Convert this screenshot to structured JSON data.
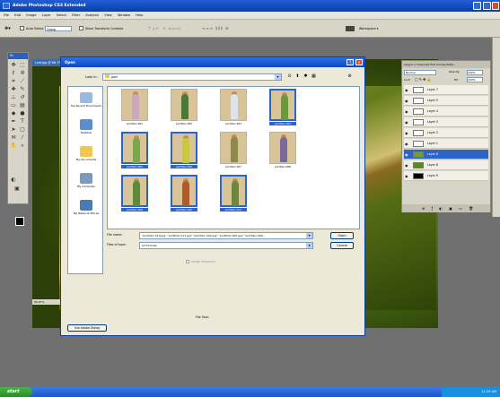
{
  "app": {
    "title": "Adobe Photoshop CS3 Extended",
    "accent": "#0a3ea8"
  },
  "menubar": [
    "File",
    "Edit",
    "Image",
    "Layer",
    "Select",
    "Filter",
    "Analysis",
    "View",
    "Window",
    "Help"
  ],
  "options_bar": {
    "auto_select_label": "Auto Select",
    "auto_select_value": "Group",
    "show_transform_label": "Show Transform Controls",
    "workspace_label": "Workspace ▾"
  },
  "toolbox": {
    "title": "Ps"
  },
  "document": {
    "title": "Leaf.jpg @ 66.7%",
    "zoom": "66.67%"
  },
  "layers_panel": {
    "tabs": "Layers × Channels  Hist Comps  Paths",
    "blend_mode": "Normal",
    "opacity_label": "Opacity:",
    "opacity_value": "100%",
    "lock_label": "Lock:",
    "fill_label": "Fill:",
    "fill_value": "100%",
    "layers": [
      {
        "name": "Layer 7",
        "selected": false,
        "thumb": "#ffffff"
      },
      {
        "name": "Layer 5",
        "selected": false,
        "thumb": "#ffffff"
      },
      {
        "name": "Layer 4",
        "selected": false,
        "thumb": "#ffffff"
      },
      {
        "name": "Layer 3",
        "selected": false,
        "thumb": "#ffffff"
      },
      {
        "name": "Layer 2",
        "selected": false,
        "thumb": "#ffffff"
      },
      {
        "name": "Layer 1",
        "selected": false,
        "thumb": "#ffffff"
      },
      {
        "name": "Layer 6",
        "selected": true,
        "thumb": "#7a9a2a"
      },
      {
        "name": "Layer 8",
        "selected": false,
        "thumb": "#5a8a1a"
      },
      {
        "name": "Layer 9",
        "selected": false,
        "thumb": "#000000"
      }
    ]
  },
  "dialog": {
    "title": "Open",
    "look_in_label": "Look in:",
    "look_in_value": "pod",
    "places": [
      "My Recent Documents",
      "Desktop",
      "My Documents",
      "My Computer",
      "My Network Places"
    ],
    "files": [
      {
        "name": "portfolio 001",
        "selected": false,
        "figure": "#c9a8c0"
      },
      {
        "name": "portfolio 002",
        "selected": false,
        "figure": "#4a7a3a"
      },
      {
        "name": "portfolio 003",
        "selected": false,
        "figure": "#dde4ee"
      },
      {
        "name": "portfolio 004",
        "selected": true,
        "figure": "#6a9a3a"
      },
      {
        "name": "portfolio 005",
        "selected": true,
        "figure": "#7aa84a"
      },
      {
        "name": "portfolio 006",
        "selected": true,
        "figure": "#c8c83a"
      },
      {
        "name": "portfolio 007",
        "selected": false,
        "figure": "#8a8a4a"
      },
      {
        "name": "portfolio 008",
        "selected": false,
        "figure": "#7a6a9a"
      },
      {
        "name": "portfolio 009",
        "selected": true,
        "figure": "#5a8a3a"
      },
      {
        "name": "portfolio 010",
        "selected": true,
        "figure": "#b05a2a"
      },
      {
        "name": "portfolio 011",
        "selected": true,
        "figure": "#6a8a3a"
      }
    ],
    "file_name_label": "File name:",
    "file_name_value": "\"portfolio 010.jpg\" \"portfolio 011.jpg\" \"portfolio 004.jpg\" \"portfolio 005.jpg\" \"portfolio 006...",
    "file_type_label": "Files of type:",
    "file_type_value": "All Formats",
    "open_button": "Open",
    "cancel_button": "Cancel",
    "image_sequence_label": "Image Sequence",
    "file_size_label": "File Size:",
    "use_adobe_dialog": "Use Adobe Dialog"
  },
  "taskbar": {
    "start_label": "start",
    "clock": "11:29 AM"
  }
}
